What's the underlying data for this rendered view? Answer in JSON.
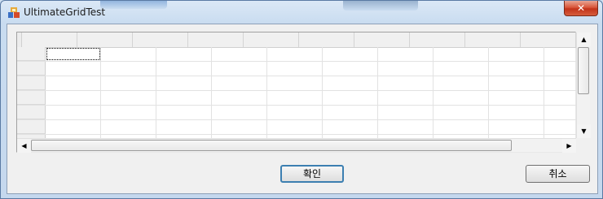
{
  "window": {
    "title": "UltimateGridTest",
    "close_symbol": "✕",
    "app_icon": "app-icon"
  },
  "grid": {
    "column_count": 10,
    "row_count": 7,
    "current_cell": {
      "row": 1,
      "column": 1
    }
  },
  "scrollbars": {
    "vertical": {
      "up_symbol": "▲",
      "down_symbol": "▼"
    },
    "horizontal": {
      "left_symbol": "◀",
      "right_symbol": "▶"
    }
  },
  "buttons": {
    "ok_label": "확인",
    "cancel_label": "취소"
  }
}
